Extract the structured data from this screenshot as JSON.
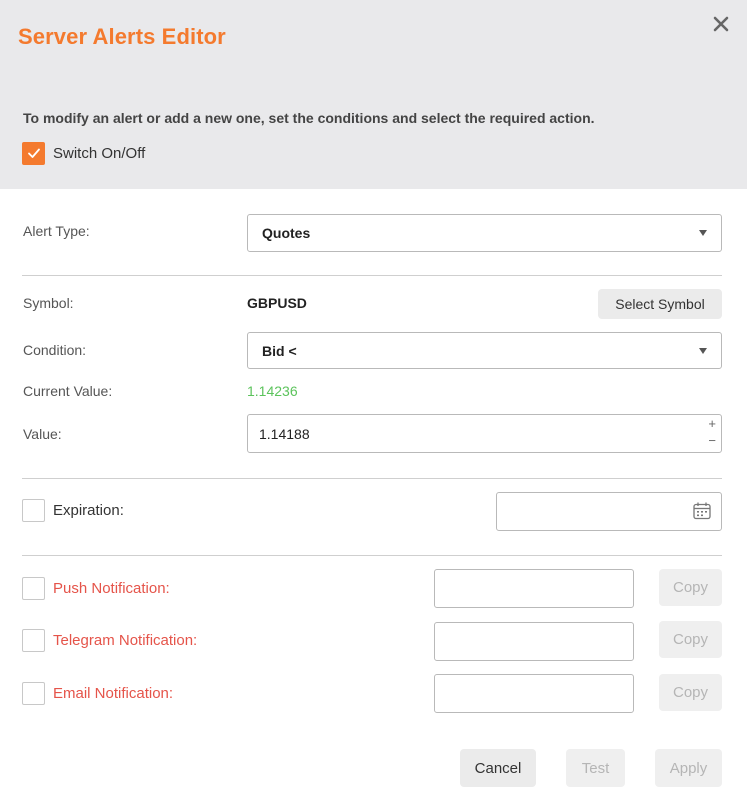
{
  "dialog": {
    "title": "Server Alerts Editor",
    "intro": "To modify an alert or add a new one, set the conditions and select the required action.",
    "switch": {
      "label": "Switch On/Off",
      "checked": true
    }
  },
  "form": {
    "alert_type": {
      "label": "Alert Type:",
      "value": "Quotes"
    },
    "symbol": {
      "label": "Symbol:",
      "value": "GBPUSD",
      "button": "Select Symbol"
    },
    "condition": {
      "label": "Condition:",
      "value": "Bid <"
    },
    "current_value": {
      "label": "Current Value:",
      "value": "1.14236"
    },
    "value": {
      "label": "Value:",
      "value": "1.14188",
      "plus": "+",
      "minus": "−"
    },
    "expiration": {
      "label": "Expiration:",
      "checked": false,
      "value": ""
    }
  },
  "notifications": [
    {
      "label": "Push Notification:",
      "value": "",
      "copy": "Copy"
    },
    {
      "label": "Telegram Notification:",
      "value": "",
      "copy": "Copy"
    },
    {
      "label": "Email Notification:",
      "value": "",
      "copy": "Copy"
    }
  ],
  "footer": {
    "cancel": "Cancel",
    "test": "Test",
    "apply": "Apply"
  },
  "colors": {
    "accent": "#f47a2e",
    "notification_label": "#e5544a",
    "current_value": "#5cc35c",
    "header_bg": "#e9e9eb"
  }
}
